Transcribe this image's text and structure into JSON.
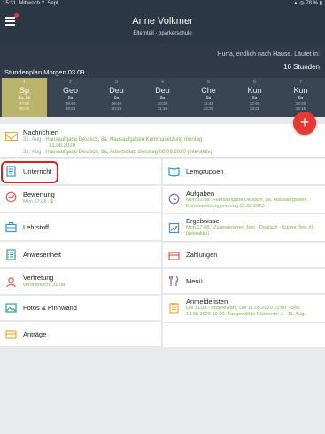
{
  "statusbar": {
    "time": "15:31",
    "date": "Mittwoch 2. Sept.",
    "battery": "78 %"
  },
  "header": {
    "user_name": "Anne Volkmer",
    "subtitle": "Elternteil · pparkerschule"
  },
  "banner": {
    "message": "Hurra, endlich nach Hause. Läutet in:",
    "hours": "16 Stunden",
    "schedule_title": "Stundenplan Morgen 03.09."
  },
  "schedule": [
    {
      "num": "1",
      "subject": "Sp",
      "cls": "8a, 8b",
      "start": "07:50",
      "end": "08:35",
      "current": true
    },
    {
      "num": "2",
      "subject": "Geo",
      "cls": "8a",
      "start": "08:40",
      "end": "09:25",
      "current": false
    },
    {
      "num": "3",
      "subject": "Deu",
      "cls": "8a",
      "start": "09:40",
      "end": "10:25",
      "current": false
    },
    {
      "num": "4",
      "subject": "Deu",
      "cls": "8a",
      "start": "10:30",
      "end": "11:15",
      "current": false
    },
    {
      "num": "5",
      "subject": "Che",
      "cls": "8a",
      "start": "11:45",
      "end": "12:30",
      "current": false
    },
    {
      "num": "6",
      "subject": "Kun",
      "cls": "8a",
      "start": "12:40",
      "end": "13:25",
      "current": false
    },
    {
      "num": "7",
      "subject": "Kun",
      "cls": "8a",
      "start": "13:30",
      "end": "14:15",
      "current": false
    }
  ],
  "fab": {
    "label": "+"
  },
  "messages": {
    "title": "Nachrichten",
    "items": [
      {
        "date": "31. Aug",
        "text": "Hausaufgabe Deutsch, 8a, Hausaufgaben Kommasetzung montag"
      },
      {
        "date": "",
        "text": "31.08.2020"
      },
      {
        "date": "31. Aug",
        "text": "Hausaufgabe Deutsch, 8a, Arbeitsblatt dienstag 08.09.2020 (interaktiv)"
      }
    ]
  },
  "tiles": {
    "unterricht": {
      "title": "Unterricht"
    },
    "lerngruppen": {
      "title": "Lerngruppen"
    },
    "bewertung": {
      "title": "Bewertung",
      "sub": "Mon 17.08.: ",
      "sub_n": "1"
    },
    "aufgaben": {
      "title": "Aufgaben",
      "sub": "Mon 31.08.: Hausaufgabe Deutsch, 8a, Hausaufgaben Kommasetzung montag 31.08.2020"
    },
    "lehrstoff": {
      "title": "Lehrstoff"
    },
    "ergebnisse": {
      "title": "Ergebnisse",
      "sub": "Mon 17.08.: Zugewiesener Test · Deutsch · Kurzer Test #1 (interaktiv)"
    },
    "anwesenheit": {
      "title": "Anwesenheit"
    },
    "zahlungen": {
      "title": "Zahlungen"
    },
    "vertretung": {
      "title": "Vertretung",
      "sub": "veröffentlicht 31.08."
    },
    "menue": {
      "title": "Menü"
    },
    "fotos": {
      "title": "Fotos & Pinnwand"
    },
    "anmeldelisten": {
      "title": "Anmeldelisten",
      "sub": "Die 11.08.: Projektwahl; Die 11.08.2020 10:00 - Don 13.08.2020 12:00. Ausgewählte Elemente: 1 · 11. Aug..."
    },
    "antraege": {
      "title": "Anträge"
    }
  },
  "colors": {
    "header": "#2c3745",
    "accent_green": "#7ab04a",
    "fab": "#e53935",
    "current_lesson": "#b9b36b",
    "highlight": "#e02020"
  },
  "icons": [
    "menu-icon",
    "envelope-icon",
    "document-icon",
    "book-icon",
    "chart-icon",
    "clock-icon",
    "briefcase-icon",
    "image-icon",
    "checklist-icon",
    "card-icon",
    "person-icon",
    "fork-knife-icon",
    "clipboard-icon",
    "shopping-bag-icon"
  ]
}
